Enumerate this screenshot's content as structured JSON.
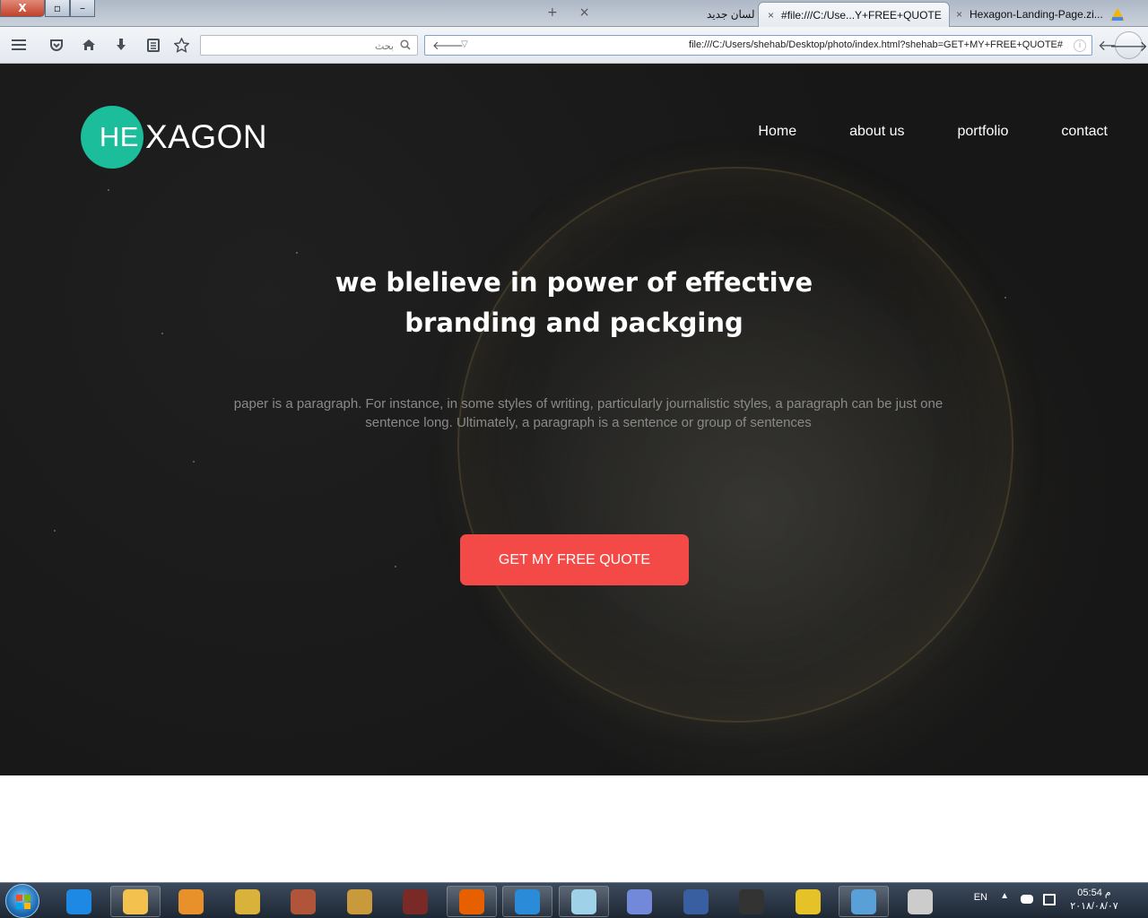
{
  "browser": {
    "window_buttons": {
      "close": "X",
      "restore": "▫",
      "minimize": "–"
    },
    "tabs": [
      {
        "label": "لسان جديد"
      },
      {
        "label": "#file:///C:/Use...Y+FREE+QUOTE",
        "active": true
      },
      {
        "label": "Hexagon-Landing-Page.zi..."
      }
    ],
    "new_tab": "+",
    "close_tab": "×",
    "search_placeholder": "بحث",
    "url": "file:///C:/Users/shehab/Desktop/photo/index.html?shehab=GET+MY+FREE+QUOTE#"
  },
  "site": {
    "logo": {
      "circle_text": "HE",
      "rest_text": "XAGON",
      "accent_color": "#1bbd9b"
    },
    "nav": [
      {
        "label": "Home"
      },
      {
        "label": "about us"
      },
      {
        "label": "portfolio"
      },
      {
        "label": "contact"
      }
    ],
    "headline_line1": "we blelieve in power of effective",
    "headline_line2": "branding and packging",
    "paragraph_line1": "paper is a paragraph. For instance, in some styles of writing, particularly journalistic styles, a paragraph can be just one",
    "paragraph_line2": "sentence long. Ultimately, a paragraph is a sentence or group of sentences",
    "cta_label": "GET MY FREE QUOTE",
    "cta_color": "#f44a47"
  },
  "taskbar": {
    "apps": [
      {
        "name": "internet-explorer-icon",
        "color": "#1e88e5"
      },
      {
        "name": "file-explorer-icon",
        "color": "#f2c14e"
      },
      {
        "name": "media-player-icon",
        "color": "#e8912a"
      },
      {
        "name": "game-shield-icon",
        "color": "#d8b23a"
      },
      {
        "name": "game-character-icon",
        "color": "#b0543a"
      },
      {
        "name": "game-logo-d-icon",
        "color": "#c99a3b"
      },
      {
        "name": "game-warrior-icon",
        "color": "#7a2a26"
      },
      {
        "name": "firefox-icon",
        "color": "#e66000"
      },
      {
        "name": "vscode-icon",
        "color": "#2a8bd9"
      },
      {
        "name": "notepad-icon",
        "color": "#9fd2e8"
      },
      {
        "name": "discord-icon",
        "color": "#7289da"
      },
      {
        "name": "game-admin-icon",
        "color": "#3a5fa0"
      },
      {
        "name": "penguin-admin-icon",
        "color": "#333333"
      },
      {
        "name": "video-editor-icon",
        "color": "#e6c229"
      },
      {
        "name": "photo-viewer-icon",
        "color": "#5aa0d8"
      },
      {
        "name": "paint-brush-icon",
        "color": "#cccccc"
      }
    ],
    "language": "EN",
    "time": "05:54 م",
    "date": "٢٠١٨/٠٨/٠٧"
  }
}
